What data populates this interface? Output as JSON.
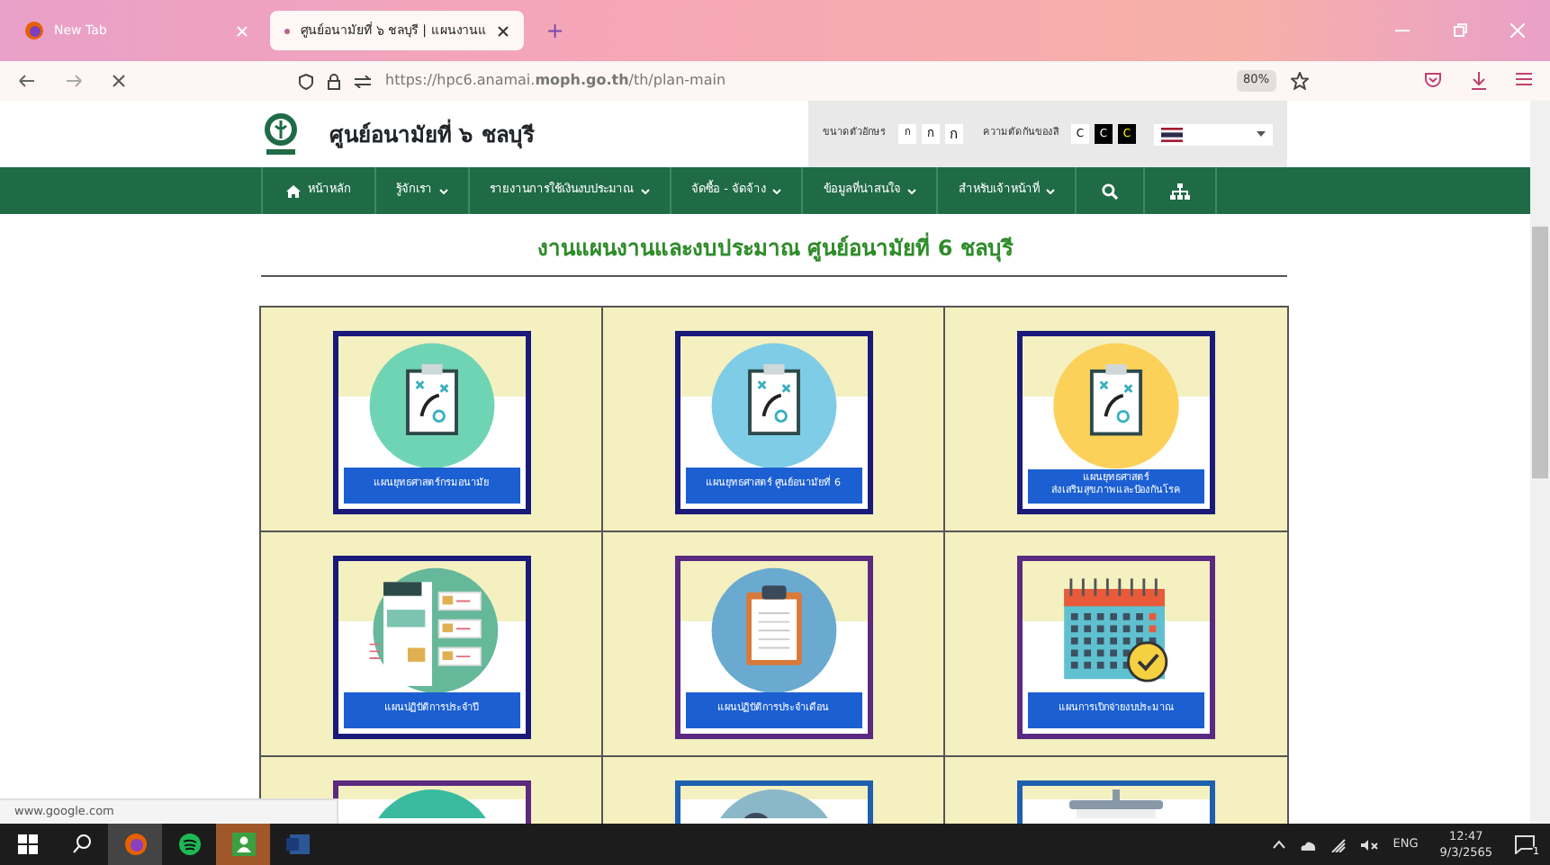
{
  "browser": {
    "tabs": [
      {
        "title": "New Tab",
        "selected": false
      },
      {
        "title": "ศูนย์อนามัยที่ ๖ ชลบุรี | แผนงานแ",
        "selected": true
      }
    ],
    "new_tab": "+",
    "url": "https://hpc6.anamai.**moph.go.th**/th/plan-main",
    "zoom": "80%"
  },
  "header": {
    "site_title": "ศูนย์อนามัยที่ ๖ ชลบุรี",
    "font_size_label": "ขนาดตัวอักษร",
    "font_sizes": [
      "ก",
      "ก",
      "ก"
    ],
    "contrast_label": "ความตัดกันของสี",
    "contrast": [
      {
        "label": "C",
        "kind": "light"
      },
      {
        "label": "C",
        "kind": "dark"
      },
      {
        "label": "C",
        "kind": "yellow"
      }
    ]
  },
  "nav": [
    {
      "label": "หน้าหลัก",
      "kind": "home"
    },
    {
      "label": "รู้จักเรา",
      "kind": "dropdown"
    },
    {
      "label": "รายงานการใช้เงินงบประมาณ",
      "kind": "dropdown"
    },
    {
      "label": "จัดซื้อ - จัดจ้าง",
      "kind": "dropdown"
    },
    {
      "label": "ข้อมูลที่น่าสนใจ",
      "kind": "dropdown"
    },
    {
      "label": "สำหรับเจ้าหน้าที่",
      "kind": "dropdown"
    },
    {
      "kind": "search"
    },
    {
      "kind": "sitemap"
    }
  ],
  "page_title": "งานแผนงานและงบประมาณ ศูนย์อนามัยที่ 6 ชลบุรี",
  "cards": [
    {
      "lines": [
        "แผนยุทธศาสตร์กรมอนามัย"
      ],
      "kind": "strategygreen",
      "color": "#1a1a7a"
    },
    {
      "lines": [
        "แผนยุทธศาสตร์ ศูนย์อนามัยที่ 6"
      ],
      "kind": "strategyblue",
      "color": "#1a1a7a"
    },
    {
      "lines": [
        "แผนยุทธศาสตร์",
        "ส่งเสริมสุขภาพและป้องกันโรค"
      ],
      "kind": "strategyyellow",
      "color": "#1a1a7a"
    },
    {
      "lines": [
        "แผนปฏิบัติการประจำปี"
      ],
      "kind": "flowchart",
      "color": "#1a1a7a"
    },
    {
      "lines": [
        "แผนปฏิบัติการประจำเดือน"
      ],
      "kind": "clipboard",
      "color": "#5a2a80"
    },
    {
      "lines": [
        "แผนการเบิกจ่ายงบประมาณ"
      ],
      "kind": "calendar",
      "color": "#5a2a80"
    },
    {
      "kind": "document",
      "color": "#5a2a80"
    },
    {
      "kind": "gears",
      "color": "#1f5fb0"
    },
    {
      "kind": "board",
      "color": "#1f5fb0"
    }
  ],
  "status_link": "www.google.com",
  "taskbar": {
    "language": "ENG",
    "time": "12:47",
    "date": "9/3/2565",
    "notifications": "1"
  }
}
